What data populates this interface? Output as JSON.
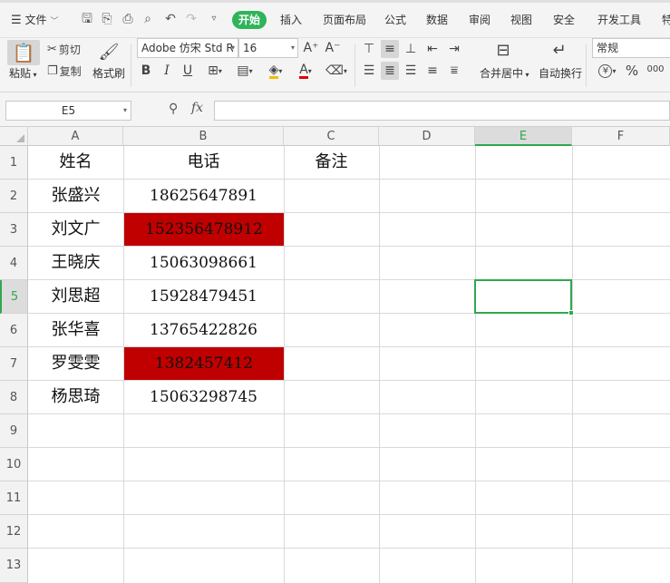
{
  "menubar": {
    "file_label": "文件",
    "tabs": [
      "开始",
      "插入",
      "页面布局",
      "公式",
      "数据",
      "审阅",
      "视图",
      "安全",
      "开发工具",
      "特"
    ]
  },
  "ribbon": {
    "paste": "粘贴",
    "cut": "剪切",
    "copy": "复制",
    "format_painter": "格式刷",
    "font_name": "Adobe 仿宋 Std R",
    "font_size": "16",
    "merge_center": "合并居中",
    "wrap_text": "自动换行",
    "number_format": "常规",
    "currency_symbol": "¥",
    "percent_symbol": "%",
    "thousands_symbol": "000"
  },
  "formula_bar": {
    "cell_ref": "E5",
    "fx_label": "fx",
    "formula": ""
  },
  "grid": {
    "columns": [
      "A",
      "B",
      "C",
      "D",
      "E",
      "F"
    ],
    "rows": [
      "1",
      "2",
      "3",
      "4",
      "5",
      "6",
      "7",
      "8",
      "9",
      "10",
      "11",
      "12",
      "13"
    ],
    "active_column": "E",
    "active_row": "5",
    "highlight_color": "#c00000",
    "accent_color": "#2fa84f",
    "cells": {
      "A1": "姓名",
      "B1": "电话",
      "C1": "备注",
      "A2": "张盛兴",
      "B2": "18625647891",
      "A3": "刘文广",
      "B3": "152356478912",
      "A4": "王晓庆",
      "B4": "15063098661",
      "A5": "刘思超",
      "B5": "15928479451",
      "A6": "张华喜",
      "B6": "13765422826",
      "A7": "罗雯雯",
      "B7": "1382457412",
      "A8": "杨思琦",
      "B8": "15063298745"
    }
  }
}
